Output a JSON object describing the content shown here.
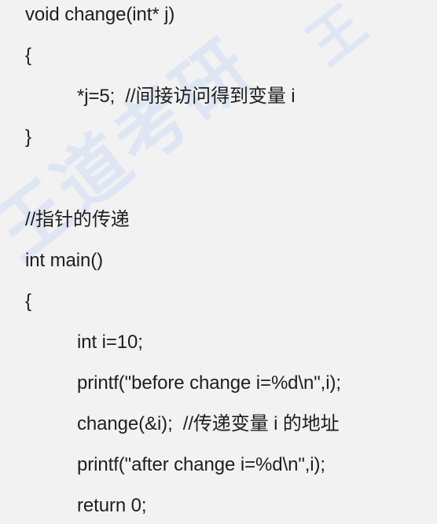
{
  "watermark": {
    "main": "王道考研",
    "top": "王"
  },
  "code": [
    "void change(int* j)",
    "{",
    "*j=5;  //间接访问得到变量 i",
    "}",
    "//指针的传递",
    "int main()",
    "{",
    "int i=10;",
    "printf(\"before change i=%d\\n\",i);",
    "change(&i);  //传递变量 i 的地址",
    "printf(\"after change i=%d\\n\",i);",
    "return 0;"
  ]
}
